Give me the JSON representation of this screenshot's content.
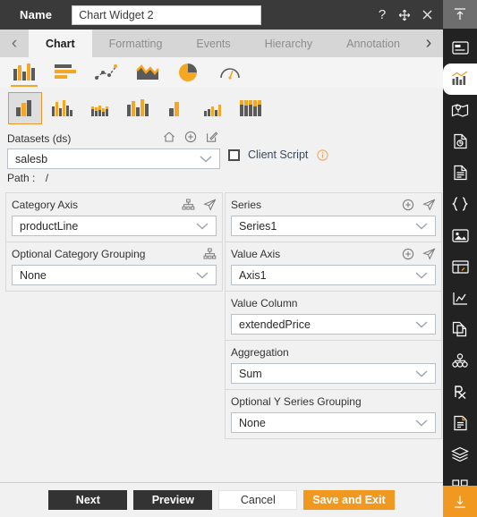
{
  "titlebar": {
    "name_label": "Name",
    "widget_name": "Chart Widget 2",
    "help_icon": "?",
    "move_icon": "move-icon",
    "close_icon": "close-icon"
  },
  "tabs": {
    "prev_arrow": "‹",
    "next_arrow": "›",
    "items": [
      {
        "label": "Chart",
        "active": true
      },
      {
        "label": "Formatting",
        "active": false
      },
      {
        "label": "Events",
        "active": false
      },
      {
        "label": "Hierarchy",
        "active": false
      },
      {
        "label": "Annotation",
        "active": false
      }
    ]
  },
  "chart_families": [
    {
      "name": "column-chart-icon",
      "selected": true
    },
    {
      "name": "bar-chart-icon",
      "selected": false
    },
    {
      "name": "scatter-line-chart-icon",
      "selected": false
    },
    {
      "name": "area-chart-icon",
      "selected": false
    },
    {
      "name": "pie-chart-icon",
      "selected": false
    },
    {
      "name": "gauge-chart-icon",
      "selected": false
    }
  ],
  "chart_variants": [
    {
      "name": "clustered-column-icon",
      "selected": true
    },
    {
      "name": "grouped-column-icon",
      "selected": false
    },
    {
      "name": "stacked-small-column-icon",
      "selected": false
    },
    {
      "name": "multi-column-icon",
      "selected": false
    },
    {
      "name": "two-column-icon",
      "selected": false
    },
    {
      "name": "mini-column-icon",
      "selected": false
    },
    {
      "name": "stacked-column-icon",
      "selected": false
    }
  ],
  "datasets": {
    "label": "Datasets (ds)",
    "home_icon": "home-icon",
    "add_icon": "add-icon",
    "edit_icon": "edit-icon",
    "value": "salesb",
    "path_label": "Path :",
    "path_value": "/"
  },
  "client_script": {
    "label": "Client Script",
    "checked": false,
    "info_icon": "info-icon"
  },
  "left_column": [
    {
      "title": "Category Axis",
      "value": "productLine",
      "icons": [
        "hierarchy-icon",
        "navigate-icon"
      ]
    },
    {
      "title": "Optional Category Grouping",
      "value": "None",
      "icons": [
        "hierarchy-icon"
      ]
    }
  ],
  "right_column": [
    {
      "title": "Series",
      "value": "Series1",
      "icons": [
        "add-icon",
        "navigate-icon"
      ]
    },
    {
      "title": "Value Axis",
      "value": "Axis1",
      "icons": [
        "add-icon",
        "navigate-icon"
      ]
    },
    {
      "title": "Value Column",
      "value": "extendedPrice",
      "icons": []
    },
    {
      "title": "Aggregation",
      "value": "Sum",
      "icons": []
    },
    {
      "title": "Optional Y Series Grouping",
      "value": "None",
      "icons": []
    }
  ],
  "footer_buttons": [
    {
      "label": "Next",
      "style": "dark"
    },
    {
      "label": "Preview",
      "style": "dark"
    },
    {
      "label": "Cancel",
      "style": "light"
    },
    {
      "label": "Save and Exit",
      "style": "orange"
    }
  ],
  "rail": {
    "top_icon": "collapse-up-icon",
    "bottom_icon": "download-icon",
    "items": [
      {
        "name": "widget-panel-icon",
        "selected": false
      },
      {
        "name": "chart-icon",
        "selected": true
      },
      {
        "name": "map-icon",
        "selected": false
      },
      {
        "name": "report-icon",
        "selected": false
      },
      {
        "name": "document-icon",
        "selected": false
      },
      {
        "name": "code-braces-icon",
        "selected": false
      },
      {
        "name": "image-icon",
        "selected": false
      },
      {
        "name": "grid-widget-icon",
        "selected": false
      },
      {
        "name": "sparkline-icon",
        "selected": false
      },
      {
        "name": "copy-pages-icon",
        "selected": false
      },
      {
        "name": "hierarchy-nodes-icon",
        "selected": false
      },
      {
        "name": "prescription-icon",
        "selected": false
      },
      {
        "name": "note-icon",
        "selected": false
      },
      {
        "name": "layers-icon",
        "selected": false
      },
      {
        "name": "tiles-icon",
        "selected": false
      }
    ]
  },
  "colors": {
    "accent": "#f0981f",
    "titlebar": "#3a3a3a",
    "rail": "#222222",
    "panel": "#f1f1f1"
  }
}
